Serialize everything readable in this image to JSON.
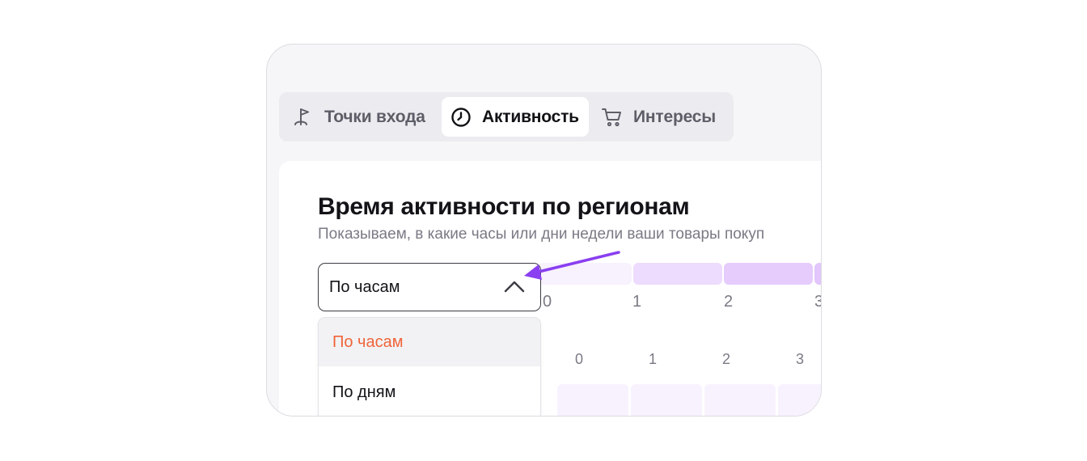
{
  "tabs": [
    {
      "label": "Точки входа",
      "icon": "golf-flag-icon",
      "active": false
    },
    {
      "label": "Активность",
      "icon": "clock-icon",
      "active": true
    },
    {
      "label": "Интересы",
      "icon": "shopping-cart-icon",
      "active": false
    }
  ],
  "card": {
    "title": "Время активности по регионам",
    "subtitle": "Показываем, в какие часы или дни недели ваши товары покуп"
  },
  "select": {
    "value": "По часам",
    "options": [
      {
        "label": "По часам",
        "selected": true
      },
      {
        "label": "По дням",
        "selected": false
      }
    ]
  },
  "axis_top": [
    "0",
    "1",
    "2",
    "3"
  ],
  "axis_bottom": [
    "0",
    "1",
    "2",
    "3"
  ],
  "colors": {
    "accent": "#8a3ff0",
    "selected_option": "#f0643a",
    "heat_light": "#f7f0fe",
    "heat_mid": "#ebd7fd",
    "heat_strong": "#e3cbfc"
  }
}
